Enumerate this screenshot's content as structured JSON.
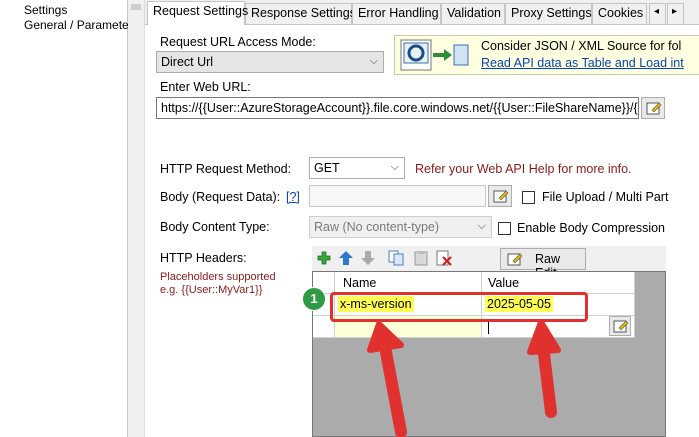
{
  "left_tree": {
    "items": [
      "Settings",
      "General / Paramete"
    ]
  },
  "tabs": [
    {
      "label": "Request Settings",
      "active": true
    },
    {
      "label": "Response Settings"
    },
    {
      "label": "Error Handling"
    },
    {
      "label": "Validation"
    },
    {
      "label": "Proxy Settings"
    },
    {
      "label": "Cookies"
    }
  ],
  "tab_scroll": {
    "left": "◂",
    "right": "▸"
  },
  "request": {
    "access_mode_label": "Request URL Access Mode:",
    "access_mode_value": "Direct Url",
    "url_label": "Enter Web URL:",
    "url_value": "https://{{User::AzureStorageAccount}}.file.core.windows.net/{{User::FileShareName}}/{{User",
    "method_label": "HTTP Request Method:",
    "method_value": "GET",
    "method_hint": "Refer your Web API Help for more info.",
    "body_label": "Body (Request Data):",
    "body_help": "[?]",
    "file_upload_label": "File Upload / Multi Part",
    "content_type_label": "Body Content Type:",
    "content_type_value": "Raw (No content-type)",
    "compression_label": "Enable Body Compression",
    "headers_label": "HTTP Headers:",
    "placeholder_note_line1": "Placeholders supported",
    "placeholder_note_line2": "e.g. {{User::MyVar1}}"
  },
  "promo": {
    "line1": "Consider JSON / XML Source for fol",
    "line2": "Read API data as Table and Load int"
  },
  "headers_toolbar": {
    "raw_edit_label": "Raw Edit"
  },
  "headers_grid": {
    "columns": [
      "Name",
      "Value"
    ],
    "rows": [
      {
        "name": "x-ms-version",
        "value": "2025-05-05"
      }
    ]
  },
  "annotation": {
    "badge": "1"
  },
  "colors": {
    "annotation_red": "#e0312f",
    "badge_green": "#2e9a43",
    "highlight_yellow": "#ffff55"
  }
}
